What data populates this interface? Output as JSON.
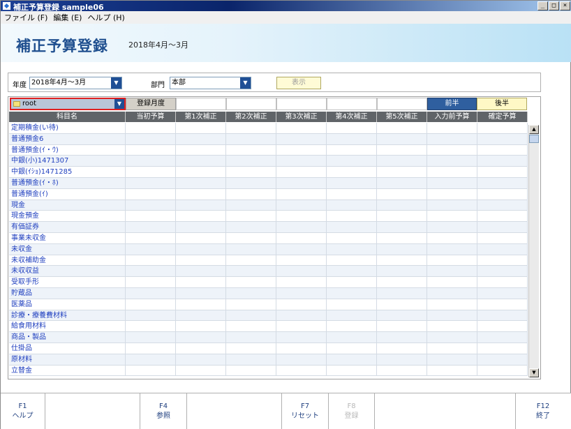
{
  "window": {
    "title": "補正予算登録 sample06",
    "buttons": [
      "_",
      "□",
      "×"
    ]
  },
  "menu": [
    {
      "label": "ファイル (F)"
    },
    {
      "label": "編集 (E)"
    },
    {
      "label": "ヘルプ (H)"
    }
  ],
  "header": {
    "title": "補正予算登録",
    "period": "2018年4月～3月"
  },
  "filter": {
    "year_label": "年度",
    "year_value": "2018年4月～3月",
    "dept_label": "部門",
    "dept_value": "本部",
    "show_button": "表示"
  },
  "grid": {
    "root_value": "root",
    "reg_month_label": "登録月度",
    "half_first": "前半",
    "half_second": "後半",
    "columns": [
      "科目名",
      "当初予算",
      "第1次補正",
      "第2次補正",
      "第3次補正",
      "第4次補正",
      "第5次補正",
      "入力前予算",
      "確定予算"
    ],
    "rows": [
      "定期積金(い待)",
      "普通預金6",
      "普通預金(ｲ・ｳ)",
      "中銀(小)1471307",
      "中銀(ｲｼｮ)1471285",
      "普通預金(ｲ・ﾎ)",
      "普通預金(ｲ)",
      "現金",
      "現金預金",
      "有価証券",
      "事業未収金",
      "未収金",
      "未収補助金",
      "未収収益",
      "受取手形",
      "貯蔵品",
      "医薬品",
      "診療・療養費材料",
      "給食用材料",
      "商品・製品",
      "仕掛品",
      "原材料",
      "立替金"
    ]
  },
  "fkeys": [
    {
      "key": "F1",
      "label": "ヘルプ",
      "enabled": true
    },
    {
      "key": "",
      "label": "",
      "enabled": false
    },
    {
      "key": "F4",
      "label": "参照",
      "enabled": true
    },
    {
      "key": "",
      "label": "",
      "enabled": false
    },
    {
      "key": "F7",
      "label": "リセット",
      "enabled": true
    },
    {
      "key": "F8",
      "label": "登録",
      "enabled": false
    },
    {
      "key": "",
      "label": "",
      "enabled": false
    },
    {
      "key": "F12",
      "label": "終了",
      "enabled": true
    }
  ]
}
